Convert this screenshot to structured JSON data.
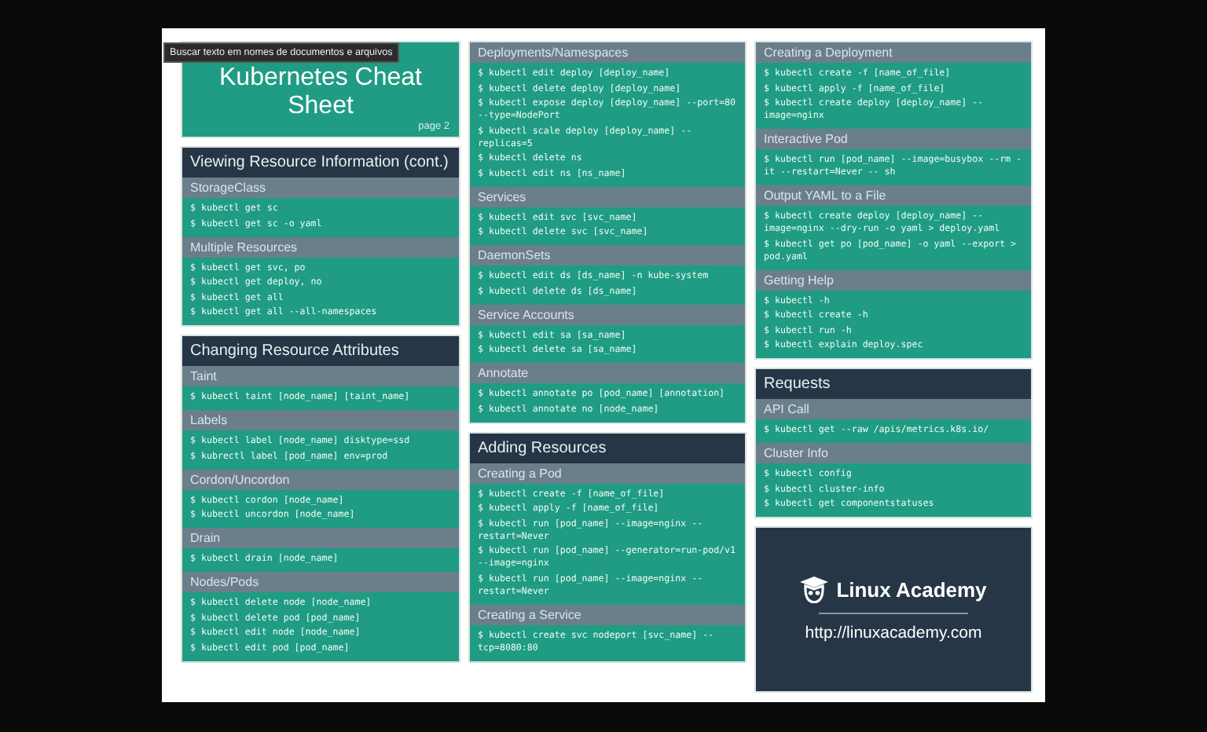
{
  "tooltip": "Buscar texto em nomes de documentos e arquivos",
  "title_card": {
    "title": "Kubernetes Cheat Sheet",
    "page": "page 2"
  },
  "columns": [
    [
      {
        "heading": "Viewing Resource Information (cont.)",
        "groups": [
          {
            "title": "StorageClass",
            "commands": [
              "$ kubectl get sc",
              "$ kubectl get sc -o yaml"
            ]
          },
          {
            "title": "Multiple Resources",
            "commands": [
              "$ kubectl get svc, po",
              "$ kubectl get deploy, no",
              "$ kubectl get all",
              "$ kubectl get all --all-namespaces"
            ]
          }
        ]
      },
      {
        "heading": "Changing Resource Attributes",
        "groups": [
          {
            "title": "Taint",
            "commands": [
              "$ kubectl taint [node_name] [taint_name]"
            ]
          },
          {
            "title": "Labels",
            "commands": [
              "$ kubectl label [node_name] disktype=ssd",
              "$ kubrectl label [pod_name] env=prod"
            ]
          },
          {
            "title": "Cordon/Uncordon",
            "commands": [
              "$ kubectl cordon [node_name]",
              "$ kubectl uncordon [node_name]"
            ]
          },
          {
            "title": "Drain",
            "commands": [
              "$ kubectl drain [node_name]"
            ]
          },
          {
            "title": "Nodes/Pods",
            "commands": [
              "$ kubectl delete node [node_name]",
              "$ kubectl delete pod [pod_name]",
              "$ kubectl edit node [node_name]",
              "$ kubectl edit pod [pod_name]"
            ]
          }
        ]
      }
    ],
    [
      {
        "groups": [
          {
            "title": "Deployments/Namespaces",
            "commands": [
              "$ kubectl edit deploy [deploy_name]",
              "$ kubectl delete deploy [deploy_name]",
              "$ kubectl expose deploy [deploy_name] --port=80 --type=NodePort",
              "$ kubectl scale deploy [deploy_name] --replicas=5",
              "$ kubectl delete ns",
              "$ kubectl edit ns [ns_name]"
            ]
          },
          {
            "title": "Services",
            "commands": [
              "$ kubectl edit svc [svc_name]",
              "$ kubectl delete svc [svc_name]"
            ]
          },
          {
            "title": "DaemonSets",
            "commands": [
              "$ kubectl edit ds [ds_name] -n kube-system",
              "$ kubectl delete ds [ds_name]"
            ]
          },
          {
            "title": "Service Accounts",
            "commands": [
              "$ kubectl edit sa [sa_name]",
              "$ kubectl delete sa [sa_name]"
            ]
          },
          {
            "title": "Annotate",
            "commands": [
              "$ kubectl annotate po [pod_name] [annotation]",
              "$ kubectl annotate no [node_name]"
            ]
          }
        ]
      },
      {
        "heading": "Adding Resources",
        "groups": [
          {
            "title": "Creating a Pod",
            "commands": [
              "$ kubectl create -f [name_of_file]",
              "$ kubectl apply -f [name_of_file]",
              "$ kubectl run [pod_name] --image=nginx --restart=Never",
              "$ kubectl run [pod_name] --generator=run-pod/v1 --image=nginx",
              "$ kubectl run [pod_name] --image=nginx --restart=Never"
            ]
          },
          {
            "title": "Creating a Service",
            "commands": [
              "$ kubectl create svc nodeport [svc_name] --tcp=8080:80"
            ]
          }
        ]
      }
    ],
    [
      {
        "groups": [
          {
            "title": "Creating a Deployment",
            "commands": [
              "$ kubectl create -f [name_of_file]",
              "$ kubectl apply -f [name_of_file]",
              "$ kubectl create deploy [deploy_name] --image=nginx"
            ]
          },
          {
            "title": "Interactive Pod",
            "commands": [
              "$ kubectl run [pod_name] --image=busybox --rm -it --restart=Never -- sh"
            ]
          },
          {
            "title": "Output YAML to a File",
            "commands": [
              "$ kubectl create deploy [deploy_name] --image=nginx --dry-run -o yaml > deploy.yaml",
              "$ kubectl get po [pod_name] -o yaml --export > pod.yaml"
            ]
          },
          {
            "title": "Getting Help",
            "commands": [
              "$ kubectl -h",
              "$ kubectl create -h",
              "$ kubectl run -h",
              "$ kubectl explain deploy.spec"
            ]
          }
        ]
      },
      {
        "heading": "Requests",
        "groups": [
          {
            "title": "API Call",
            "commands": [
              "$ kubectl get --raw /apis/metrics.k8s.io/"
            ]
          },
          {
            "title": "Cluster Info",
            "commands": [
              "$ kubectl config",
              "$ kubectl cluster-info",
              "$ kubectl get componentstatuses"
            ]
          }
        ]
      }
    ]
  ],
  "logo_card": {
    "brand": "Linux Academy",
    "url": "http://linuxacademy.com"
  }
}
